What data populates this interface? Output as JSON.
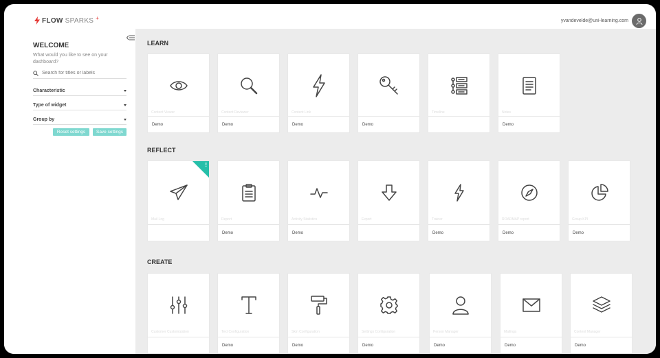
{
  "app": {
    "logo_flow": "FLOW",
    "logo_sparks": "SPARKS",
    "logo_plus": "+",
    "user_email": "yvandevelde@uni-learning.com"
  },
  "sidebar": {
    "welcome": "WELCOME",
    "subtitle": "What would you like to see on your dashboard?",
    "search_placeholder": "Search for titles or labels",
    "filters": [
      "Characteristic",
      "Type of widget",
      "Group by"
    ],
    "reset_label": "Reset settings",
    "save_label": "Save settings"
  },
  "sections": [
    {
      "title": "LEARN",
      "cards": [
        {
          "title": "Content Viewer",
          "footer": "Demo",
          "icon": "eye-icon"
        },
        {
          "title": "Content Reviewer",
          "footer": "Demo",
          "icon": "magnifier-icon"
        },
        {
          "title": "Content Link",
          "footer": "Demo",
          "icon": "lightning-icon"
        },
        {
          "title": "",
          "footer": "Demo",
          "icon": "key-icon"
        },
        {
          "title": "Timeline",
          "footer": "",
          "icon": "timeline-icon"
        },
        {
          "title": "Notes",
          "footer": "Demo",
          "icon": "notes-icon"
        }
      ]
    },
    {
      "title": "REFLECT",
      "cards": [
        {
          "title": "Mail Log",
          "footer": "",
          "icon": "paper-plane-icon",
          "badge": "!"
        },
        {
          "title": "Report",
          "footer": "Demo",
          "icon": "clipboard-icon"
        },
        {
          "title": "Activity Statistics",
          "footer": "Demo",
          "icon": "pulse-icon"
        },
        {
          "title": "Export",
          "footer": "",
          "icon": "arrow-down-icon"
        },
        {
          "title": "Trainer",
          "footer": "Demo",
          "icon": "lightning-small-icon"
        },
        {
          "title": "ROADMAP report",
          "footer": "Demo",
          "icon": "compass-icon"
        },
        {
          "title": "Group KPI",
          "footer": "Demo",
          "icon": "pie-chart-icon"
        }
      ]
    },
    {
      "title": "CREATE",
      "cards": [
        {
          "title": "Customer Customization",
          "footer": "",
          "icon": "sliders-icon"
        },
        {
          "title": "Text Configuration",
          "footer": "Demo",
          "icon": "text-icon"
        },
        {
          "title": "Skin Configuration",
          "footer": "Demo",
          "icon": "paint-roller-icon"
        },
        {
          "title": "Settings Configuration",
          "footer": "Demo",
          "icon": "gear-icon"
        },
        {
          "title": "Person Manager",
          "footer": "Demo",
          "icon": "person-icon"
        },
        {
          "title": "Mailings",
          "footer": "Demo",
          "icon": "envelope-icon"
        },
        {
          "title": "Content Manager",
          "footer": "Demo",
          "icon": "layers-icon"
        }
      ]
    }
  ]
}
